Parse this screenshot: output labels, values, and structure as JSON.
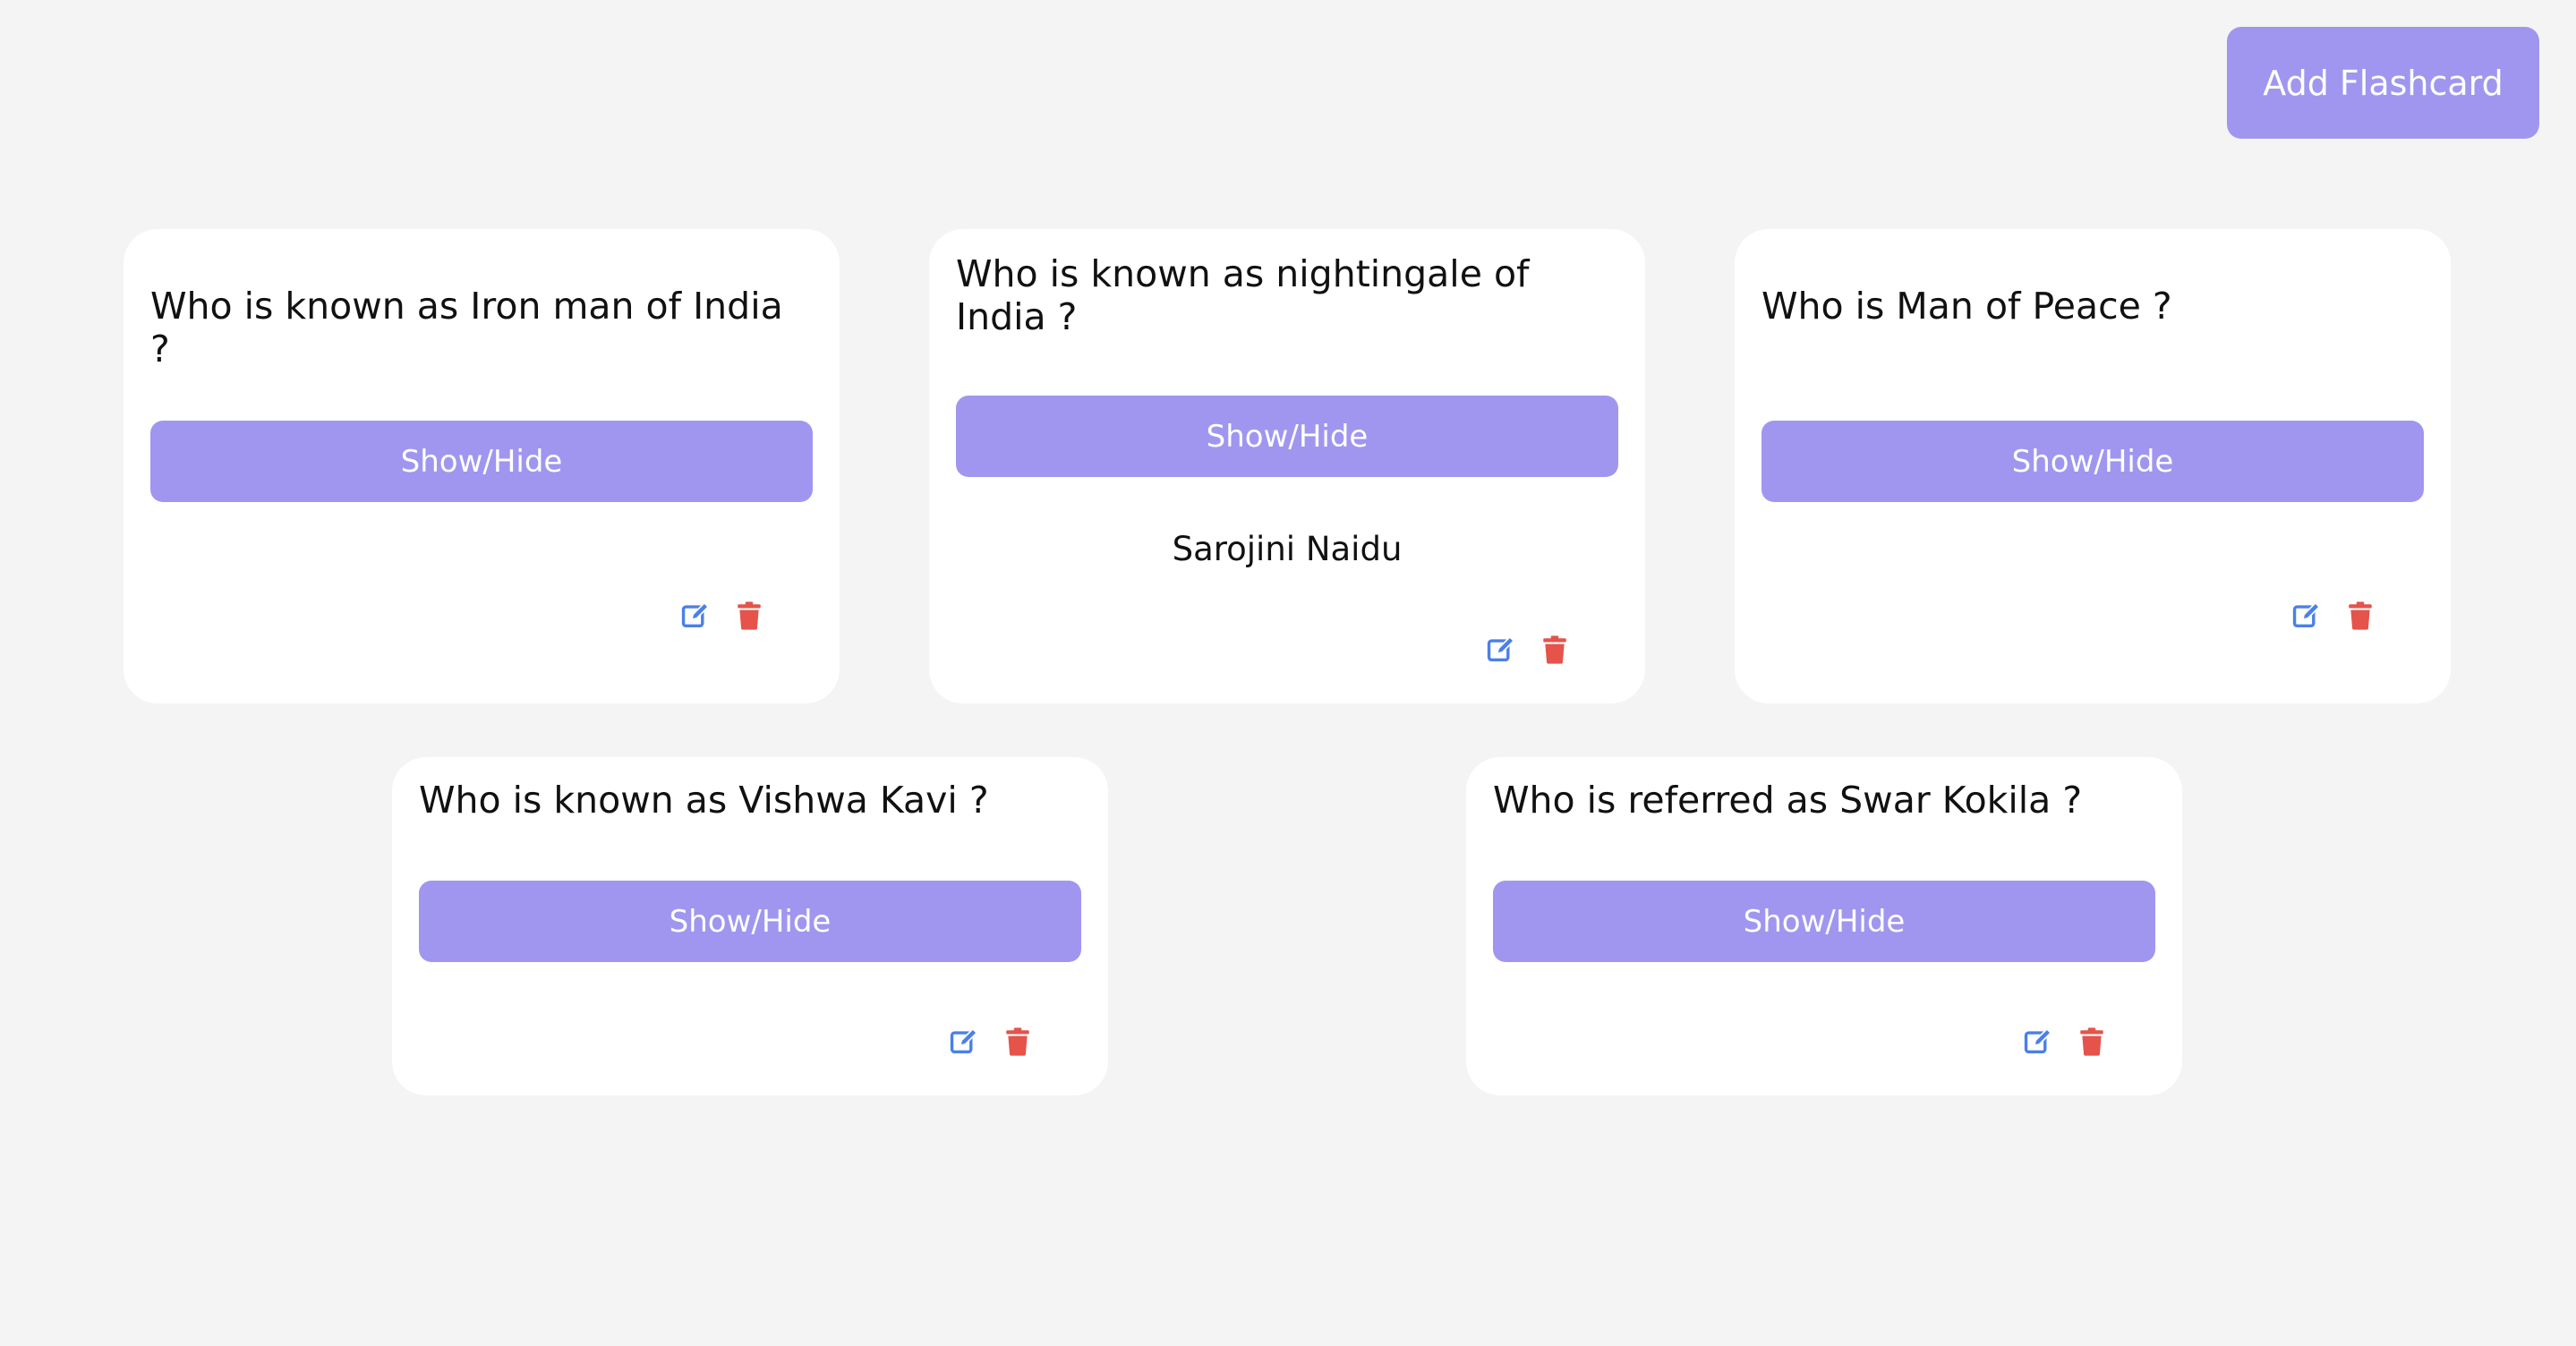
{
  "header": {
    "add_button_label": "Add Flashcard"
  },
  "cards": [
    {
      "question": "Who is known as Iron man of India ?",
      "toggle_label": "Show/Hide",
      "answer": "",
      "edit_icon": "edit-icon",
      "delete_icon": "trash-icon"
    },
    {
      "question": "Who is known as nightingale of India ?",
      "toggle_label": "Show/Hide",
      "answer": "Sarojini Naidu",
      "edit_icon": "edit-icon",
      "delete_icon": "trash-icon"
    },
    {
      "question": "Who is Man of Peace ?",
      "toggle_label": "Show/Hide",
      "answer": "",
      "edit_icon": "edit-icon",
      "delete_icon": "trash-icon"
    },
    {
      "question": "Who is known as Vishwa Kavi ?",
      "toggle_label": "Show/Hide",
      "answer": "",
      "edit_icon": "edit-icon",
      "delete_icon": "trash-icon"
    },
    {
      "question": "Who is referred as Swar Kokila ?",
      "toggle_label": "Show/Hide",
      "answer": "",
      "edit_icon": "edit-icon",
      "delete_icon": "trash-icon"
    }
  ],
  "colors": {
    "page_background": "#f4f4f4",
    "accent": "#a096f0",
    "edit_icon": "#4a80e8",
    "delete_icon": "#e5534b"
  }
}
